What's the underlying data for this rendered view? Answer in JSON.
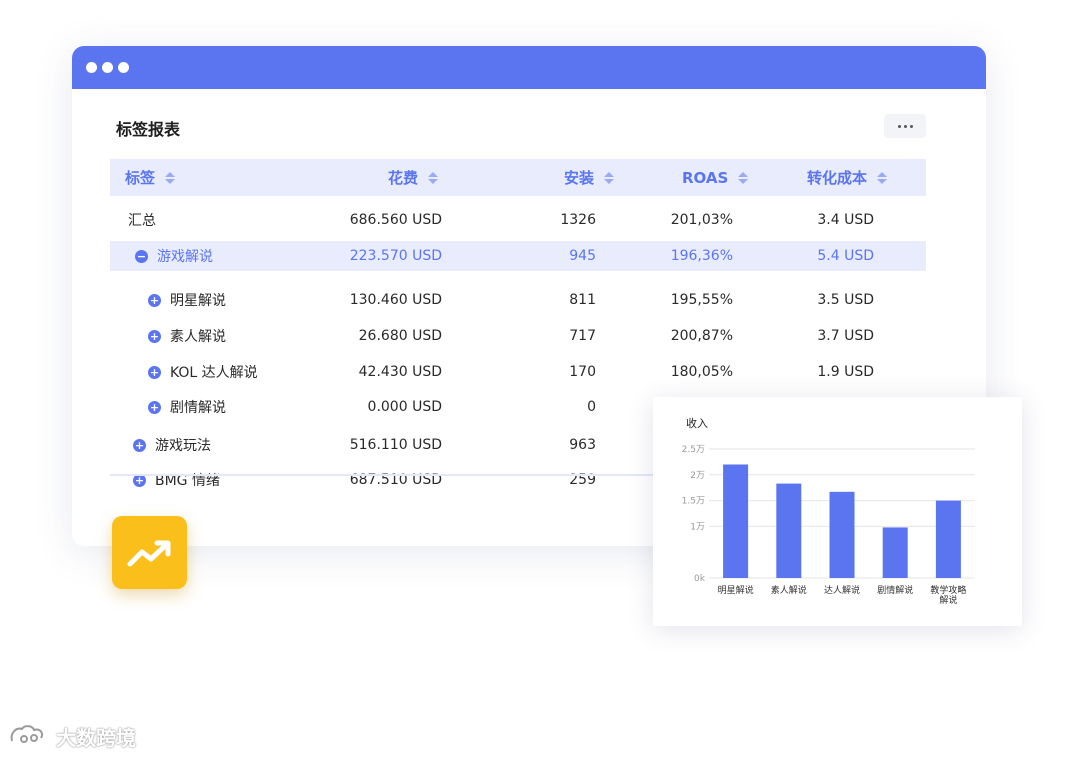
{
  "report": {
    "title": "标签报表",
    "columns": [
      "标签",
      "花费",
      "安装",
      "ROAS",
      "转化成本"
    ],
    "rows": [
      {
        "label": "汇总",
        "spend": "686.560 USD",
        "installs": "1326",
        "roas": "201,03%",
        "cpa": "3.4 USD",
        "toggle": ""
      },
      {
        "label": "游戏解说",
        "spend": "223.570 USD",
        "installs": "945",
        "roas": "196,36%",
        "cpa": "5.4 USD",
        "toggle": "collapse"
      },
      {
        "label": "明星解说",
        "spend": "130.460 USD",
        "installs": "811",
        "roas": "195,55%",
        "cpa": "3.5 USD",
        "toggle": "expand"
      },
      {
        "label": "素人解说",
        "spend": "26.680 USD",
        "installs": "717",
        "roas": "200,87%",
        "cpa": "3.7 USD",
        "toggle": "expand"
      },
      {
        "label": "KOL 达人解说",
        "spend": "42.430 USD",
        "installs": "170",
        "roas": "180,05%",
        "cpa": "1.9 USD",
        "toggle": "expand"
      },
      {
        "label": "剧情解说",
        "spend": "0.000 USD",
        "installs": "0",
        "roas": "",
        "cpa": "",
        "toggle": "expand"
      },
      {
        "label": "游戏玩法",
        "spend": "516.110 USD",
        "installs": "963",
        "roas": "",
        "cpa": "",
        "toggle": "expand"
      },
      {
        "label": "BMG 情绪",
        "spend": "687.510 USD",
        "installs": "259",
        "roas": "",
        "cpa": "",
        "toggle": "expand"
      }
    ]
  },
  "icons": {
    "more": "more-dots-icon",
    "trend": "trending-up-icon",
    "expand": "plus-circle-icon",
    "collapse": "minus-circle-icon"
  },
  "colors": {
    "accent": "#5b75f1",
    "highlight": "#e8ecfd",
    "trend_tile": "#fbbf1c"
  },
  "chart_data": {
    "type": "bar",
    "ylabel": "收入",
    "categories": [
      "明星解说",
      "素人解说",
      "达人解说",
      "剧情解说",
      "教学攻略解说"
    ],
    "values": [
      22000,
      18300,
      16700,
      9800,
      15000
    ],
    "ylim": [
      0,
      25000
    ],
    "y_ticks": [
      "0k",
      "1万",
      "1.5万",
      "2万",
      "2.5万"
    ],
    "grid": true,
    "color": "#5b75f1"
  },
  "watermark": "大数跨境"
}
